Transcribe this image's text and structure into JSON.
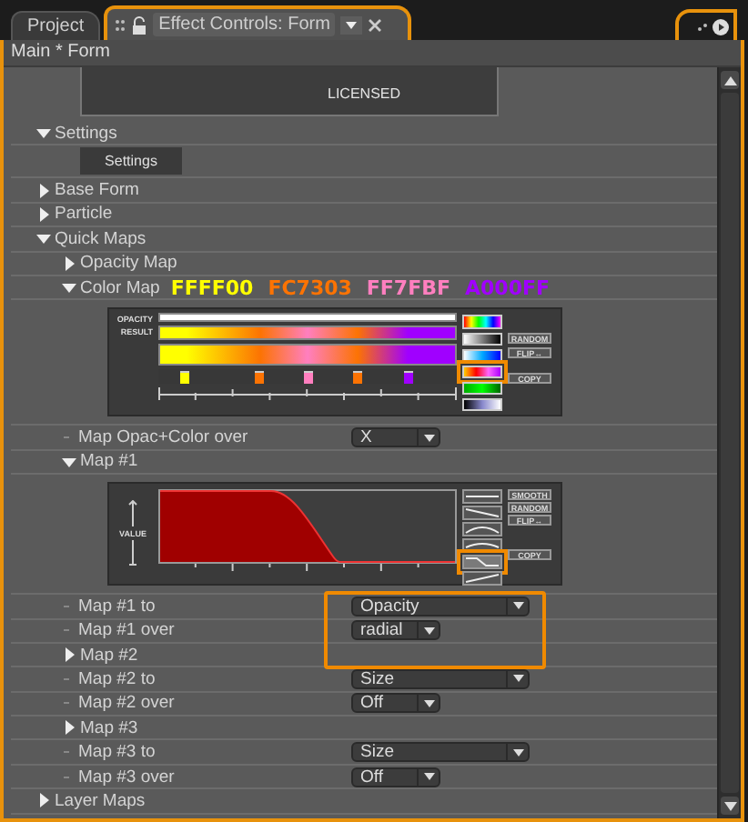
{
  "tabs": [
    {
      "label": "Project",
      "selected": false
    },
    {
      "label": "Effect Controls: Form",
      "selected": true
    }
  ],
  "breadcrumb": "Main * Form",
  "tree": [
    {
      "kind": "panel",
      "text": "LICENSED"
    },
    {
      "kind": "group",
      "label": "Settings",
      "expanded": true,
      "children": [
        {
          "kind": "button",
          "label": "Settings"
        }
      ]
    },
    {
      "kind": "group",
      "label": "Base Form",
      "expanded": false
    },
    {
      "kind": "group",
      "label": "Particle",
      "expanded": false
    },
    {
      "kind": "group",
      "label": "Quick Maps",
      "expanded": true,
      "children": [
        {
          "kind": "group",
          "label": "Opacity Map",
          "expanded": false
        },
        {
          "kind": "group",
          "label": "Color Map",
          "expanded": true,
          "swatches": [
            {
              "label": "FFFF00",
              "color": "#ffff00"
            },
            {
              "label": "FC7303",
              "color": "#fc7303"
            },
            {
              "label": "FF7FBF",
              "color": "#ff7fbf"
            },
            {
              "label": "A000FF",
              "color": "#a000ff"
            }
          ],
          "children": [
            {
              "kind": "colormap",
              "row_labels": [
                "OPACITY",
                "RESULT"
              ],
              "stops": [
                {
                  "color": "#ffff00",
                  "level": 0.09
                },
                {
                  "color": "#fc7303",
                  "level": 0.34
                },
                {
                  "color": "#ff7fbf",
                  "level": 0.5
                },
                {
                  "color": "#fc7303",
                  "level": 0.67
                },
                {
                  "color": "#a000ff",
                  "level": 0.84
                }
              ],
              "presets": [
                {
                  "selected": false
                },
                {
                  "selected": false
                },
                {
                  "selected": false
                },
                {
                  "selected": true
                },
                {
                  "selected": false
                },
                {
                  "selected": false
                }
              ],
              "buttons": [
                "RANDOM",
                "FLIP↔",
                "COPY"
              ]
            }
          ]
        },
        {
          "kind": "menu",
          "label": "Map Opac+Color over",
          "value": "X",
          "highlighted": false
        },
        {
          "kind": "group",
          "label": "Map #1",
          "expanded": true,
          "children": [
            {
              "kind": "curve",
              "axis_label": "VALUE",
              "presets": [
                {
                  "selected": false
                },
                {
                  "selected": false
                },
                {
                  "selected": false
                },
                {
                  "selected": false
                },
                {
                  "selected": true
                },
                {
                  "selected": false
                }
              ],
              "buttons": [
                "SMOOTH",
                "RANDOM",
                "FLIP↔",
                "COPY"
              ]
            }
          ]
        },
        {
          "kind": "wide-menu",
          "label": "Map #1 to",
          "value": "Opacity",
          "highlighted": true
        },
        {
          "kind": "menu",
          "label": "Map #1 over",
          "value": "radial",
          "highlighted": true
        },
        {
          "kind": "group",
          "label": "Map #2",
          "expanded": false
        },
        {
          "kind": "wide-menu",
          "label": "Map #2 to",
          "value": "Size",
          "highlighted": false
        },
        {
          "kind": "menu",
          "label": "Map #2 over",
          "value": "Off",
          "highlighted": false
        },
        {
          "kind": "group",
          "label": "Map #3",
          "expanded": false
        },
        {
          "kind": "wide-menu",
          "label": "Map #3 to",
          "value": "Size",
          "highlighted": false
        },
        {
          "kind": "menu",
          "label": "Map #3 over",
          "value": "Off",
          "highlighted": false
        }
      ]
    },
    {
      "kind": "group",
      "label": "Layer Maps",
      "expanded": false
    }
  ]
}
